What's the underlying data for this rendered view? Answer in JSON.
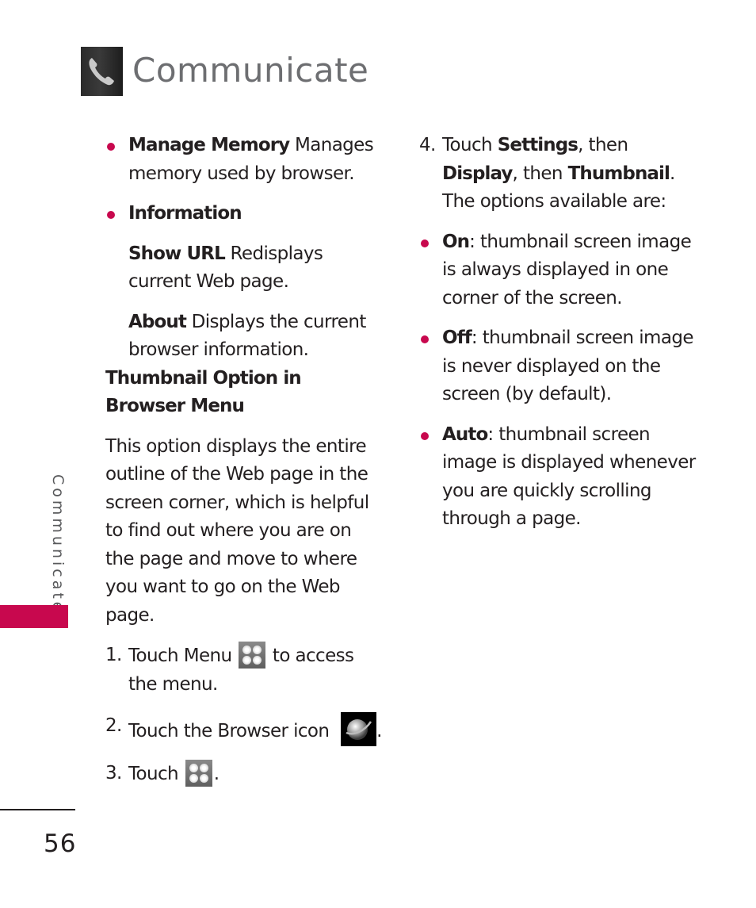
{
  "header": {
    "icon": "phone-handset-icon",
    "title": "Communicate"
  },
  "left_column": {
    "manage_memory": {
      "term": "Manage Memory",
      "desc": " Manages memory used by browser."
    },
    "information": {
      "term": "Information"
    },
    "show_url": {
      "term": "Show URL",
      "desc": " Redisplays current Web page."
    },
    "about": {
      "term": "About",
      "desc": " Displays the current browser information."
    },
    "section_heading": "Thumbnail Option in Browser Menu",
    "intro": "This option displays the entire outline of the Web page in the screen corner, which is helpful to find out where you are on the page and move to where you want to go on the Web page.",
    "steps": [
      {
        "num": "1.",
        "before": "Touch Menu ",
        "icon": "menu-grid-icon",
        "after": " to access the menu."
      },
      {
        "num": "2.",
        "before": "Touch the Browser icon ",
        "icon": "browser-globe-icon",
        "after": "."
      },
      {
        "num": "3.",
        "before": "Touch ",
        "icon": "menu-grid-icon",
        "after": "."
      }
    ]
  },
  "right_column": {
    "step4": {
      "num": "4.",
      "t1": "Touch ",
      "b1": "Settings",
      "t2": ", then ",
      "b2": "Display",
      "t3": ", then ",
      "b3": "Thumbnail",
      "t4": ". The options available are:"
    },
    "options": [
      {
        "term": "On",
        "desc": ": thumbnail screen image is always displayed in one corner of the screen."
      },
      {
        "term": "Off",
        "desc": ": thumbnail screen image is never displayed on the screen (by default)."
      },
      {
        "term": "Auto",
        "desc": ": thumbnail screen image is displayed whenever you are quickly scrolling through a page."
      }
    ]
  },
  "sidebar": {
    "section_label": "Communicate",
    "accent_color": "#c8084e"
  },
  "footer": {
    "page_number": "56"
  }
}
